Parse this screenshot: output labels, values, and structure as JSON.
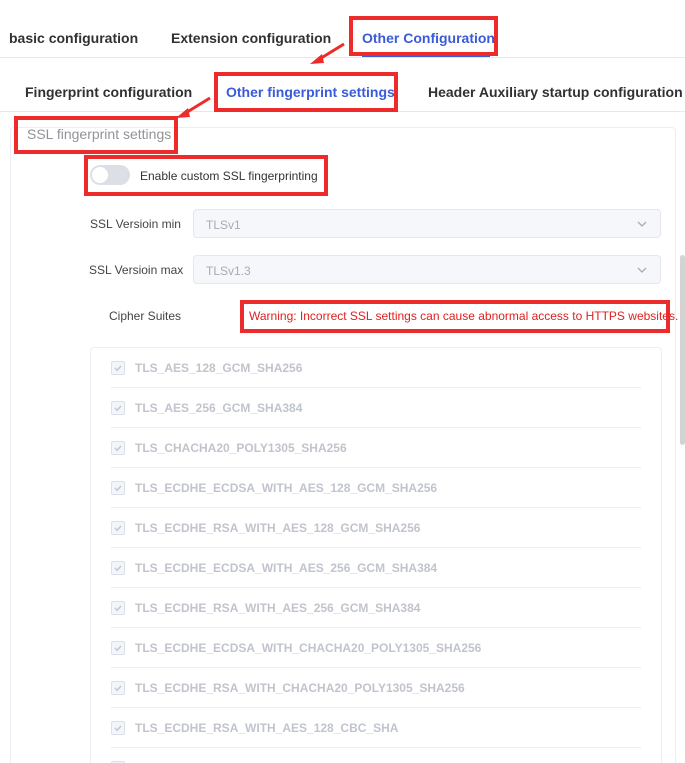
{
  "top_tabs": [
    {
      "label": "basic configuration"
    },
    {
      "label": "Extension configuration"
    },
    {
      "label": "Other Configuration"
    }
  ],
  "sub_tabs": [
    {
      "label": "Fingerprint configuration"
    },
    {
      "label": "Other fingerprint settings"
    },
    {
      "label": "Header Auxiliary startup configuration"
    }
  ],
  "section": {
    "title": "SSL fingerprint settings",
    "switch_label": "Enable custom SSL fingerprinting",
    "switch_on": false
  },
  "form": {
    "min_label": "SSL Versioin min",
    "min_value": "TLSv1",
    "max_label": "SSL Versioin max",
    "max_value": "TLSv1.3",
    "cipher_label": "Cipher Suites",
    "warning": "Warning: Incorrect SSL settings can cause abnormal access to HTTPS websites."
  },
  "ciphers": [
    "TLS_AES_128_GCM_SHA256",
    "TLS_AES_256_GCM_SHA384",
    "TLS_CHACHA20_POLY1305_SHA256",
    "TLS_ECDHE_ECDSA_WITH_AES_128_GCM_SHA256",
    "TLS_ECDHE_RSA_WITH_AES_128_GCM_SHA256",
    "TLS_ECDHE_ECDSA_WITH_AES_256_GCM_SHA384",
    "TLS_ECDHE_RSA_WITH_AES_256_GCM_SHA384",
    "TLS_ECDHE_ECDSA_WITH_CHACHA20_POLY1305_SHA256",
    "TLS_ECDHE_RSA_WITH_CHACHA20_POLY1305_SHA256",
    "TLS_ECDHE_RSA_WITH_AES_128_CBC_SHA"
  ],
  "colors": {
    "accent": "#3a5bd9",
    "annotation": "#ee2b2b",
    "warning": "#e02020"
  },
  "icons": {
    "select_chevron": "chevron-down-icon",
    "checkbox_mark": "check-icon"
  }
}
